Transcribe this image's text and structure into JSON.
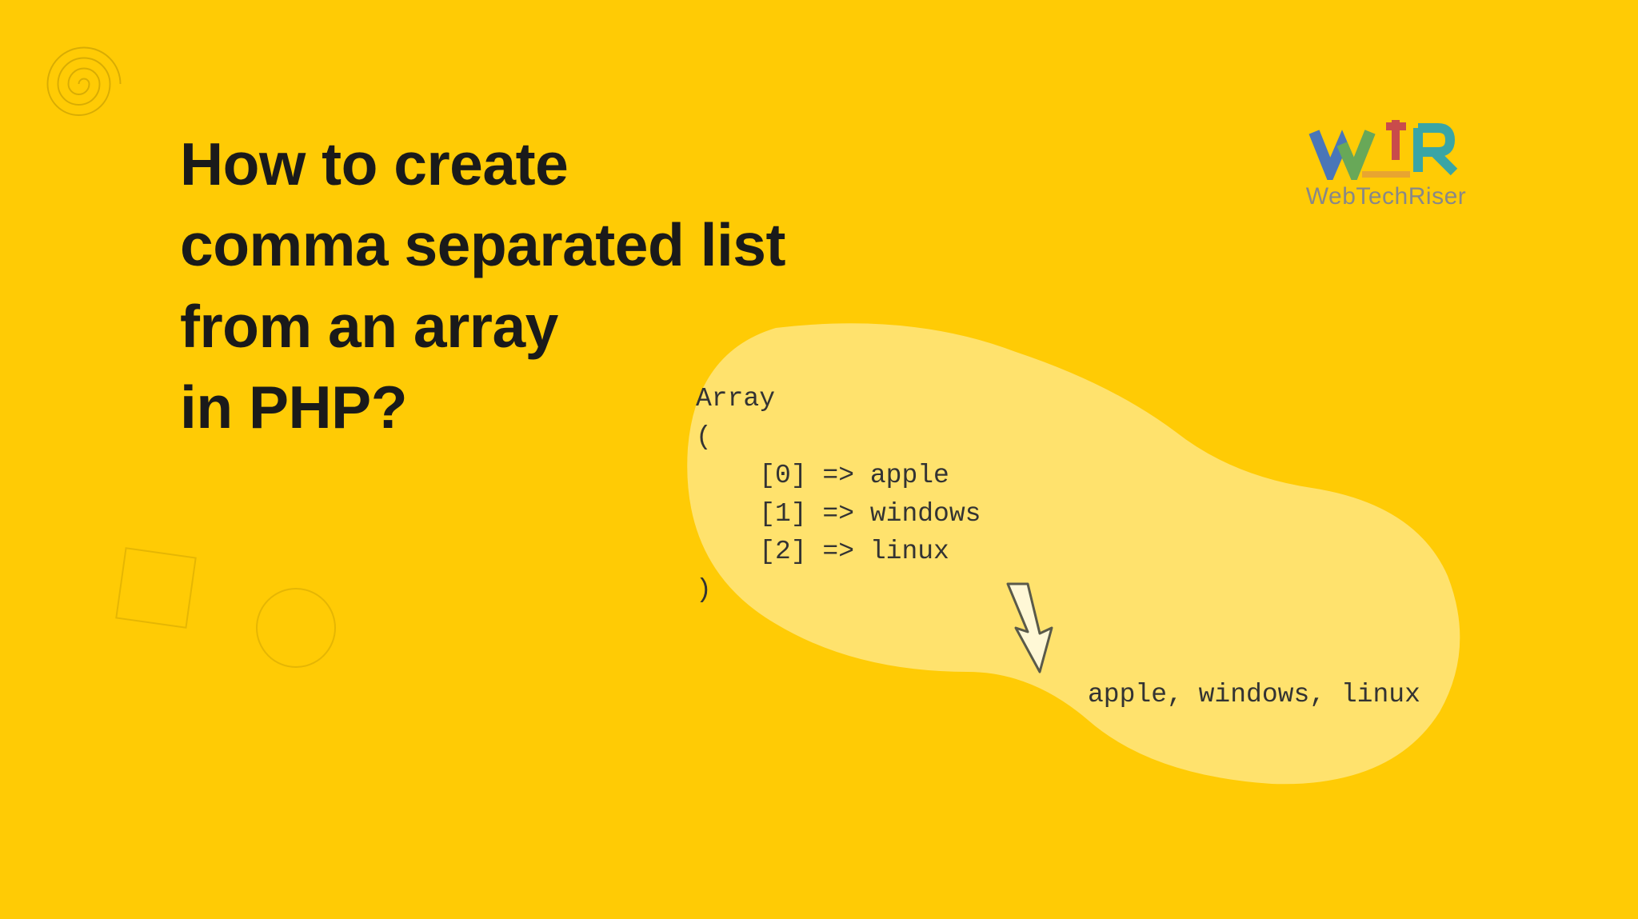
{
  "title": {
    "line1": "How to create",
    "line2": "comma separated list",
    "line3": "from an array",
    "line4": "in PHP?"
  },
  "logo": {
    "text": "WebTechRiser"
  },
  "code": {
    "line1": "Array",
    "line2": "(",
    "line3": "    [0] => apple",
    "line4": "    [1] => windows",
    "line5": "    [2] => linux",
    "line6": ")"
  },
  "result": "apple, windows, linux"
}
